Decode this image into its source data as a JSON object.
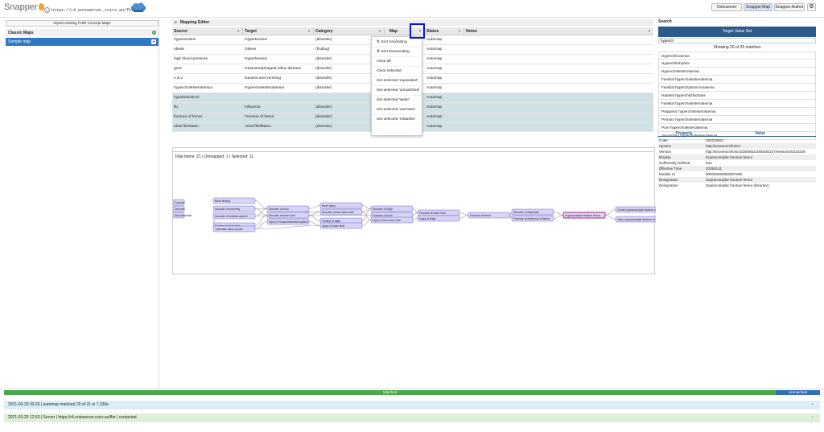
{
  "app": {
    "logo": "Snapper",
    "server_url": "https://r4.ontoserver.csiro.au/fhir",
    "buttons": {
      "ontoserver": "Ontoserver",
      "snapper_map": "Snapper:Map",
      "snapper_author": "Snapper:Author"
    },
    "settings_icon": "gear-icon"
  },
  "left": {
    "import_label": "Import existing FHIR Concept Maps",
    "classic_maps": "Classic Maps",
    "sample_map": "Sample map"
  },
  "editor": {
    "title": "Mapping Editor",
    "columns": {
      "source": "Source",
      "target": "Target",
      "category": "Category",
      "map": "Map",
      "status": "Status",
      "notes": "Notes"
    },
    "rows": [
      {
        "source": "hypertension",
        "target": "Hypertension",
        "category": "(disorder)",
        "status": "Automap",
        "selected": false
      },
      {
        "source": "obese",
        "target": "Obese",
        "category": "(finding)",
        "status": "Automap",
        "selected": false
      },
      {
        "source": "high blood pressure",
        "target": "Hypertension",
        "category": "(disorder)",
        "status": "Automap",
        "selected": false
      },
      {
        "source": "gord",
        "target": "Gastroesophageal reflux disease",
        "category": "(disorder)",
        "status": "Automap",
        "selected": false
      },
      {
        "source": "n & v",
        "target": "Nausea and vomiting",
        "category": "(disorder)",
        "status": "Automap",
        "selected": false
      },
      {
        "source": "hypercholesterolemica",
        "target": "Hypercholesterolaemia",
        "category": "(disorder)",
        "status": "Automap",
        "selected": false
      },
      {
        "source": "hypokolesterol",
        "target": "",
        "category": "",
        "status": "Automap",
        "selected": true
      },
      {
        "source": "flu",
        "target": "Influenza",
        "category": "(disorder)",
        "status": "Automap",
        "selected": true
      },
      {
        "source": "fracture of femur",
        "target": "Fracture of femur",
        "category": "(disorder)",
        "status": "Automap",
        "selected": true
      },
      {
        "source": "atrial fibrilation",
        "target": "Atrial fibrillation",
        "category": "(disorder)",
        "status": "Automap",
        "selected": true
      }
    ],
    "footer": "Total Items: 21 | Unmapped: 1 | Selected: 11",
    "menu": [
      "Sort Ascending",
      "Sort Descending",
      "Clear all",
      "Clear selected",
      "Set selected 'equivalent'",
      "Set selected 'unmatched'",
      "Set selected 'wider'",
      "Set selected 'narrower'",
      "Set selected 'relatedto'"
    ]
  },
  "graph": {
    "nodes": [
      "Bone finding",
      "Disorder of extremity",
      "Disorder of skeletal system",
      "Finding of lower limb",
      "Traumatic injury by site",
      "Disorder of bone",
      "Disorder of lower limb",
      "Injury of musculoskeletal system",
      "Bone injury",
      "Disorder of free lower limb",
      "Finding of thigh",
      "Injury of lower limb",
      "Disorder of thigh",
      "Fracture of bone",
      "Injury of free lower limb",
      "Fracture of lower limb",
      "Injury of thigh",
      "Fracture of femur",
      "Disorder of diaphysis",
      "Fracture of distal end of femur",
      "Supracondylar fracture femur",
      "Closed supracondylar fracture of femur",
      "Open supracondylar fracture of femur",
      "Fracture",
      "Disorder",
      "Non-traumatic"
    ]
  },
  "search": {
    "label": "Search",
    "button": "Target Value Set",
    "query": "hyperch",
    "matches": "Showing 20 of 26 matches",
    "results": [
      "Hyperchloraemia",
      "Hyperchlorhydria",
      "Hypercholesterolaemia",
      "Familial hypercholesterolaemia",
      "Familial hyperchylomicronaemia",
      "Isolated hyperchlorhidrosis",
      "Familial hypercholesterolaemia",
      "Polygenic hypercholesterolaemia",
      "Primary hypercholesterolaemia",
      "Pure hypercholesterolaemia",
      "Secondary hypercholesterolaemia"
    ]
  },
  "properties": {
    "head_property": "Property",
    "head_value": "Value",
    "rows": [
      [
        "Code",
        "263235001"
      ],
      [
        "System",
        "http://snomed.info/sct"
      ],
      [
        "Version",
        "http://snomed.info/sct/32506021000036107/version/20210228"
      ],
      [
        "Display",
        "Supracondylar fracture femur"
      ],
      [
        "Sufficiently Defined",
        "true"
      ],
      [
        "Effective Time",
        "20050131"
      ],
      [
        "Module Id",
        "900000000000207008"
      ],
      [
        "Designation",
        "Supracondylar fracture femur"
      ],
      [
        "Designation",
        "Supracondylar fracture femur (disorder)"
      ]
    ]
  },
  "status": {
    "matched": "Matched",
    "unmatched": "Unmatched",
    "matched_fraction": 0.946
  },
  "logs": [
    {
      "text": "2021-03-29 03:26 | automap matched 20 of 21 in 7.235s",
      "color": "#dbeef7"
    },
    {
      "text": "2021-03-29 12:53 | Server | https://r4.ontoserver.csiro.au/fhir | contacted.",
      "color": "#dff0d8"
    }
  ]
}
